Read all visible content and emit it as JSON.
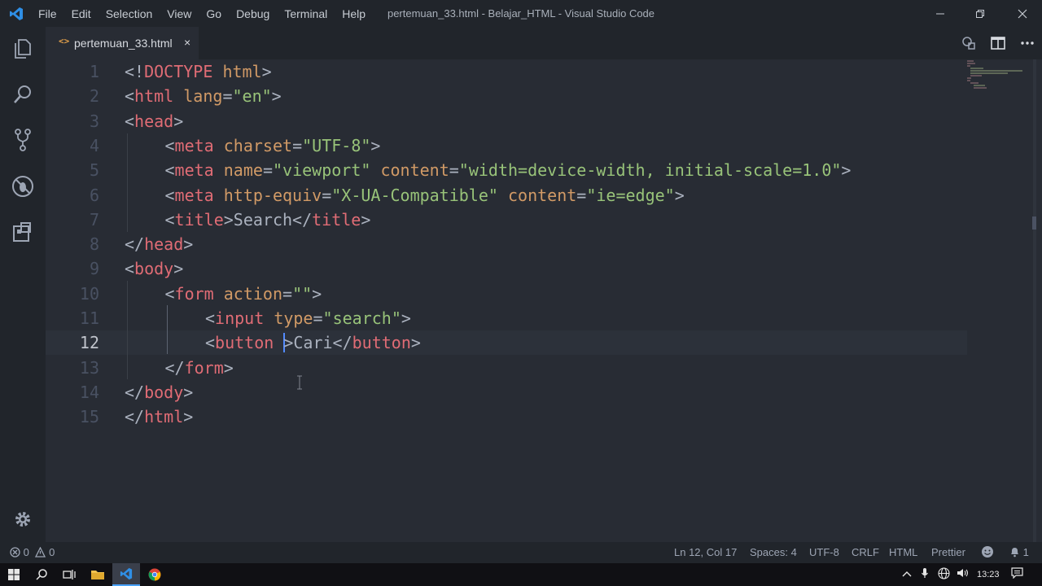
{
  "titlebar": {
    "menu": [
      "File",
      "Edit",
      "Selection",
      "View",
      "Go",
      "Debug",
      "Terminal",
      "Help"
    ],
    "window_title": "pertemuan_33.html - Belajar_HTML - Visual Studio Code"
  },
  "tab": {
    "label": "pertemuan_33.html",
    "icon": "<>",
    "close": "×"
  },
  "activity_icons": [
    "explorer-icon",
    "search-icon",
    "source-control-icon",
    "debug-icon",
    "extensions-icon",
    "gear-icon"
  ],
  "editor": {
    "current_line": 12,
    "lines": [
      {
        "n": "1",
        "indent": 0,
        "tokens": [
          [
            "p",
            "<!"
          ],
          [
            "t",
            "DOCTYPE"
          ],
          [
            "p",
            " "
          ],
          [
            "a",
            "html"
          ],
          [
            "p",
            ">"
          ]
        ]
      },
      {
        "n": "2",
        "indent": 0,
        "tokens": [
          [
            "p",
            "<"
          ],
          [
            "t",
            "html"
          ],
          [
            "p",
            " "
          ],
          [
            "a",
            "lang"
          ],
          [
            "p",
            "="
          ],
          [
            "s",
            "\"en\""
          ],
          [
            "p",
            ">"
          ]
        ]
      },
      {
        "n": "3",
        "indent": 0,
        "tokens": [
          [
            "p",
            "<"
          ],
          [
            "t",
            "head"
          ],
          [
            "p",
            ">"
          ]
        ]
      },
      {
        "n": "4",
        "indent": 1,
        "tokens": [
          [
            "p",
            "<"
          ],
          [
            "t",
            "meta"
          ],
          [
            "p",
            " "
          ],
          [
            "a",
            "charset"
          ],
          [
            "p",
            "="
          ],
          [
            "s",
            "\"UTF-8\""
          ],
          [
            "p",
            ">"
          ]
        ]
      },
      {
        "n": "5",
        "indent": 1,
        "tokens": [
          [
            "p",
            "<"
          ],
          [
            "t",
            "meta"
          ],
          [
            "p",
            " "
          ],
          [
            "a",
            "name"
          ],
          [
            "p",
            "="
          ],
          [
            "s",
            "\"viewport\""
          ],
          [
            "p",
            " "
          ],
          [
            "a",
            "content"
          ],
          [
            "p",
            "="
          ],
          [
            "s",
            "\"width=device-width, initial-scale=1.0\""
          ],
          [
            "p",
            ">"
          ]
        ]
      },
      {
        "n": "6",
        "indent": 1,
        "tokens": [
          [
            "p",
            "<"
          ],
          [
            "t",
            "meta"
          ],
          [
            "p",
            " "
          ],
          [
            "a",
            "http-equiv"
          ],
          [
            "p",
            "="
          ],
          [
            "s",
            "\"X-UA-Compatible\""
          ],
          [
            "p",
            " "
          ],
          [
            "a",
            "content"
          ],
          [
            "p",
            "="
          ],
          [
            "s",
            "\"ie=edge\""
          ],
          [
            "p",
            ">"
          ]
        ]
      },
      {
        "n": "7",
        "indent": 1,
        "tokens": [
          [
            "p",
            "<"
          ],
          [
            "t",
            "title"
          ],
          [
            "p",
            ">Search</"
          ],
          [
            "t",
            "title"
          ],
          [
            "p",
            ">"
          ]
        ]
      },
      {
        "n": "8",
        "indent": 0,
        "tokens": [
          [
            "p",
            "</"
          ],
          [
            "t",
            "head"
          ],
          [
            "p",
            ">"
          ]
        ]
      },
      {
        "n": "9",
        "indent": 0,
        "tokens": [
          [
            "p",
            "<"
          ],
          [
            "t",
            "body"
          ],
          [
            "p",
            ">"
          ]
        ]
      },
      {
        "n": "10",
        "indent": 1,
        "tokens": [
          [
            "p",
            "<"
          ],
          [
            "t",
            "form"
          ],
          [
            "p",
            " "
          ],
          [
            "a",
            "action"
          ],
          [
            "p",
            "="
          ],
          [
            "s",
            "\"\""
          ],
          [
            "p",
            ">"
          ]
        ]
      },
      {
        "n": "11",
        "indent": 2,
        "tokens": [
          [
            "p",
            "<"
          ],
          [
            "t",
            "input"
          ],
          [
            "p",
            " "
          ],
          [
            "a",
            "type"
          ],
          [
            "p",
            "="
          ],
          [
            "s",
            "\"search\""
          ],
          [
            "p",
            ">"
          ]
        ]
      },
      {
        "n": "12",
        "indent": 2,
        "tokens": [
          [
            "p",
            "<"
          ],
          [
            "t",
            "button"
          ],
          [
            "p",
            " "
          ],
          [
            "cursor",
            ""
          ],
          [
            "p",
            ">Cari</"
          ],
          [
            "t",
            "button"
          ],
          [
            "p",
            ">"
          ]
        ]
      },
      {
        "n": "13",
        "indent": 1,
        "tokens": [
          [
            "p",
            "</"
          ],
          [
            "t",
            "form"
          ],
          [
            "p",
            ">"
          ]
        ]
      },
      {
        "n": "14",
        "indent": 0,
        "tokens": [
          [
            "p",
            "</"
          ],
          [
            "t",
            "body"
          ],
          [
            "p",
            ">"
          ]
        ]
      },
      {
        "n": "15",
        "indent": 0,
        "tokens": [
          [
            "p",
            "</"
          ],
          [
            "t",
            "html"
          ],
          [
            "p",
            ">"
          ]
        ]
      }
    ]
  },
  "status": {
    "errors": "0",
    "warnings": "0",
    "position": "Ln 12, Col 17",
    "spaces": "Spaces: 4",
    "encoding": "UTF-8",
    "eol": "CRLF",
    "language": "HTML",
    "formatter": "Prettier",
    "notifications": "1"
  },
  "taskbar": {
    "clock": "13:23"
  },
  "colors": {
    "tag": "#e06c75",
    "attr": "#d19a66",
    "string": "#98c379",
    "punct": "#abb2bf",
    "accent": "#528bff"
  }
}
